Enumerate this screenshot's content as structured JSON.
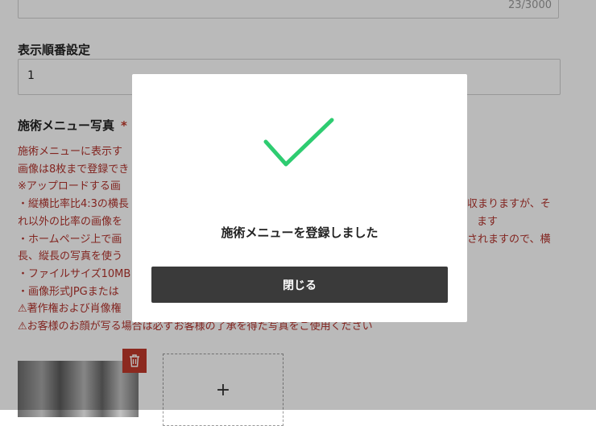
{
  "form": {
    "description_counter": "23/3000",
    "display_order": {
      "label": "表示順番設定",
      "value": "1"
    },
    "photos": {
      "label": "施術メニュー写真",
      "required_mark": "*",
      "notes": [
        "施術メニューに表示す",
        "画像は8枚まで登録でき",
        "※アップロードする画",
        "・縦横比率比4:3の横長",
        "れ以外の比率の画像を",
        "・ホームページ上で画",
        "長、縦長の写真を使う",
        "・ファイルサイズ10MB",
        "・画像形式JPGまたは",
        "⚠著作権および肖像権",
        "⚠お客様のお顔が写る場合は必ずお客様の了承を得た写真をご使用ください"
      ],
      "notes_right": {
        "line4": "収まりますが、そ",
        "line5": "ます",
        "line6": "されますので、横"
      },
      "add_symbol": "+",
      "delete_icon": "trash-icon"
    }
  },
  "modal": {
    "icon": "checkmark-icon",
    "icon_color": "#2ecc71",
    "message": "施術メニューを登録しました",
    "close_label": "閉じる"
  }
}
